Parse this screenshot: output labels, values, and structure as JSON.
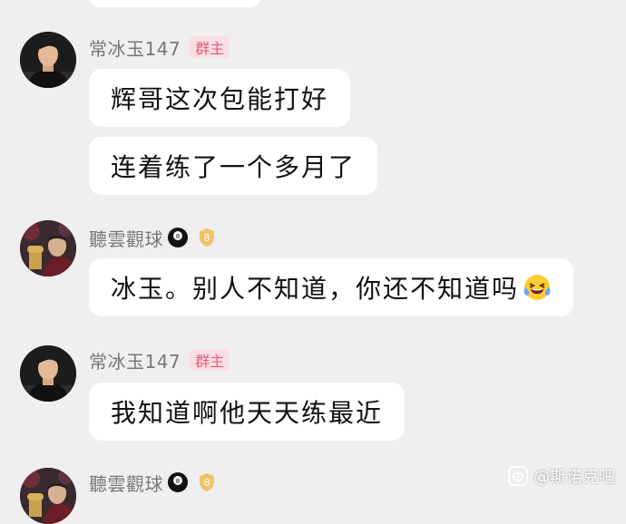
{
  "messages": [
    {
      "sender": "常冰玉147",
      "badge": "群主",
      "bubbles": [
        "辉哥这次包能打好",
        "连着练了一个多月了"
      ]
    },
    {
      "sender": "聽雲觀球",
      "badge_icon": "8-ball-icon",
      "level_badge": "8",
      "bubbles": [
        "冰玉。别人不知道，你还不知道吗"
      ],
      "emoji": "laughing-crying-emoji"
    },
    {
      "sender": "常冰玉147",
      "badge": "群主",
      "bubbles": [
        "我知道啊他天天练最近"
      ]
    },
    {
      "sender": "聽雲觀球",
      "badge_icon": "8-ball-icon",
      "level_badge": "8"
    }
  ],
  "watermark": {
    "text": "@斯诺克吧",
    "icon": "weibo-icon"
  },
  "colors": {
    "background": "#efefef",
    "bubble": "#ffffff",
    "badge_bg": "#f9dfe4",
    "badge_text": "#e35d79",
    "level_badge": "#f2c268"
  }
}
